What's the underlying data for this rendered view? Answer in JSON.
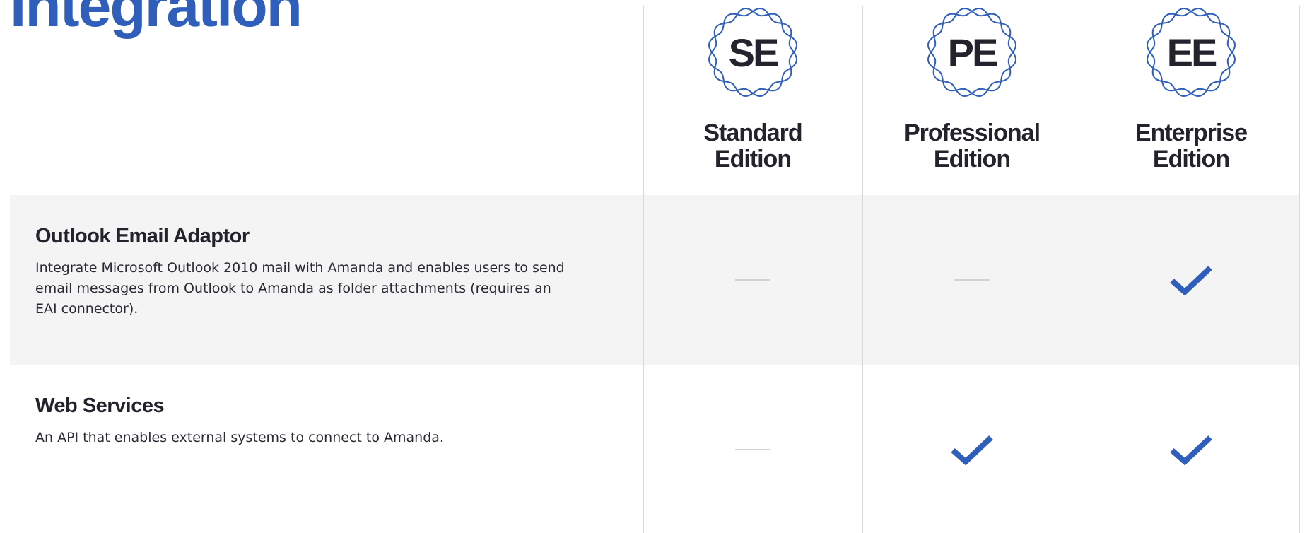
{
  "section": {
    "title": "Integration"
  },
  "editions": [
    {
      "abbr": "SE",
      "name_line1": "Standard",
      "name_line2": "Edition"
    },
    {
      "abbr": "PE",
      "name_line1": "Professional",
      "name_line2": "Edition"
    },
    {
      "abbr": "EE",
      "name_line1": "Enterprise",
      "name_line2": "Edition"
    }
  ],
  "features": [
    {
      "name": "Outlook Email Adaptor",
      "description": "Integrate Microsoft Outlook 2010 mail with Amanda and enables users to send email messages from Outlook to Amanda as folder attachments  (requires an EAI connector).",
      "availability": [
        "not-included",
        "not-included",
        "included"
      ]
    },
    {
      "name": "Web Services",
      "description": "An API that enables external systems to connect to Amanda.",
      "availability": [
        "not-included",
        "included",
        "included"
      ]
    }
  ],
  "colors": {
    "accent_blue": "#2f5fba",
    "heading_dark": "#23232e",
    "row_shade": "#f4f4f4",
    "divider": "#d9d9d9",
    "dash": "#d3d3d3"
  },
  "icons": {
    "included": "check-icon",
    "not_included": "dash-icon",
    "badge": "wavy-badge-icon"
  }
}
